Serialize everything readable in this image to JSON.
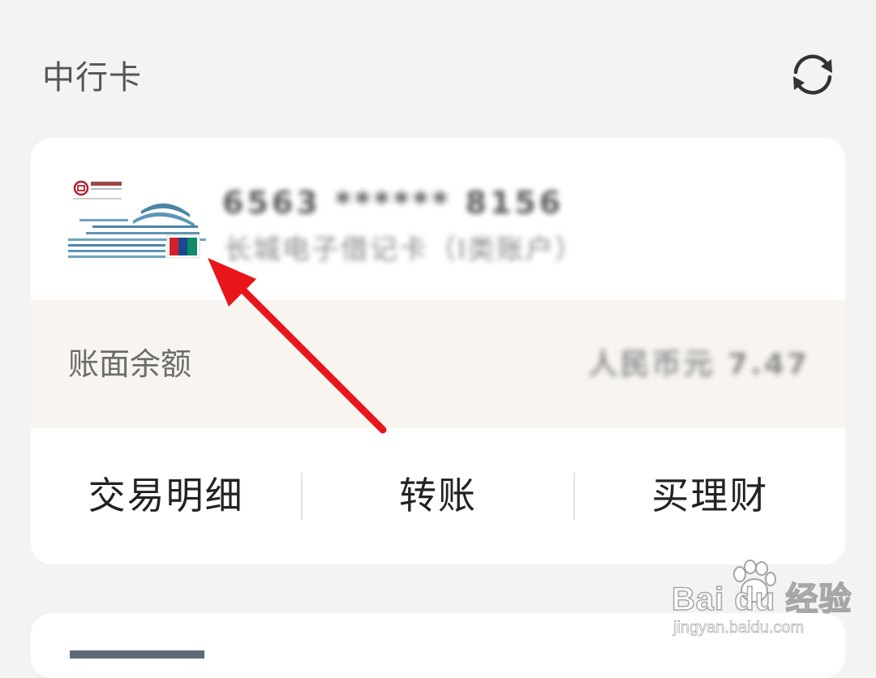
{
  "header": {
    "title": "中行卡",
    "refresh_icon": "refresh-icon"
  },
  "card": {
    "logo_icon": "bank-card-image",
    "number_masked": "6563 ****** 8156",
    "card_type": "长城电子借记卡（I类账户）",
    "balance_label": "账面余额",
    "balance_value": "人民币元 7.47",
    "actions": [
      {
        "label": "交易明细"
      },
      {
        "label": "转账"
      },
      {
        "label": "买理财"
      }
    ]
  },
  "annotation": {
    "arrow_color": "#e8161b"
  },
  "watermark": {
    "brand": "Bai du 经验",
    "url": "jingyan.baidu.com"
  },
  "colors": {
    "background": "#f3f3f3",
    "card": "#ffffff",
    "balance_row": "#f8f5f0",
    "text_primary": "#222222",
    "text_secondary": "#6c6c6c"
  }
}
